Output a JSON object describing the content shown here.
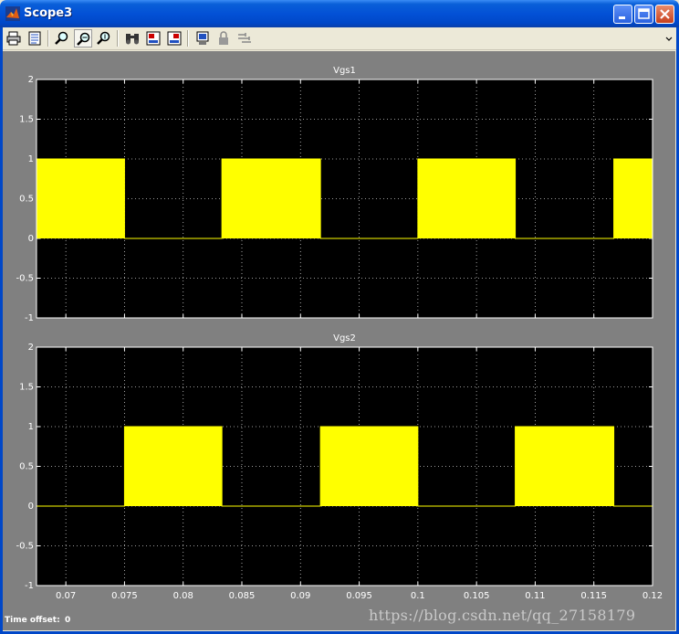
{
  "window": {
    "title": "Scope3"
  },
  "toolbar": {
    "items": [
      {
        "name": "print-icon"
      },
      {
        "name": "parameters-icon"
      },
      {
        "name": "zoom-icon"
      },
      {
        "name": "zoom-x-icon"
      },
      {
        "name": "zoom-y-icon"
      },
      {
        "name": "autoscale-icon"
      },
      {
        "name": "save-axes-settings-icon"
      },
      {
        "name": "restore-axes-settings-icon"
      },
      {
        "name": "floating-scope-icon"
      },
      {
        "name": "lock-icon"
      },
      {
        "name": "signal-selection-icon"
      }
    ]
  },
  "footer": {
    "time_offset_label": "Time offset:",
    "time_offset_value": "0"
  },
  "watermark": "https://blog.csdn.net/qq_27158179",
  "colors": {
    "trace": "#ffff00",
    "axes_bg": "#000000",
    "figure_bg": "#808080",
    "grid": "#ffffff"
  },
  "chart_data": [
    {
      "type": "line",
      "title": "Vgs1",
      "xlim": [
        0.0675,
        0.12
      ],
      "ylim": [
        -1,
        2
      ],
      "yticks": [
        "2",
        "1.5",
        "1",
        "0.5",
        "0",
        "-0.5",
        "-1"
      ],
      "xticks": [],
      "grid": true,
      "series": [
        {
          "x": [
            0.0675,
            0.075,
            0.075,
            0.0833,
            0.0833,
            0.0917,
            0.0917,
            0.1,
            0.1,
            0.1083,
            0.1083,
            0.1167,
            0.1167,
            0.12
          ],
          "y": [
            1,
            1,
            0,
            0,
            1,
            1,
            0,
            0,
            1,
            1,
            0,
            0,
            1,
            1
          ]
        }
      ]
    },
    {
      "type": "line",
      "title": "Vgs2",
      "xlim": [
        0.0675,
        0.12
      ],
      "ylim": [
        -1,
        2
      ],
      "yticks": [
        "2",
        "1.5",
        "1",
        "0.5",
        "0",
        "-0.5",
        "-1"
      ],
      "xticks": [
        "0.07",
        "0.075",
        "0.08",
        "0.085",
        "0.09",
        "0.095",
        "0.1",
        "0.105",
        "0.11",
        "0.115",
        "0.12"
      ],
      "grid": true,
      "series": [
        {
          "x": [
            0.0675,
            0.075,
            0.075,
            0.0833,
            0.0833,
            0.0917,
            0.0917,
            0.1,
            0.1,
            0.1083,
            0.1083,
            0.1167,
            0.1167,
            0.12
          ],
          "y": [
            0,
            0,
            1,
            1,
            0,
            0,
            1,
            1,
            0,
            0,
            1,
            1,
            0,
            0
          ]
        }
      ]
    }
  ]
}
